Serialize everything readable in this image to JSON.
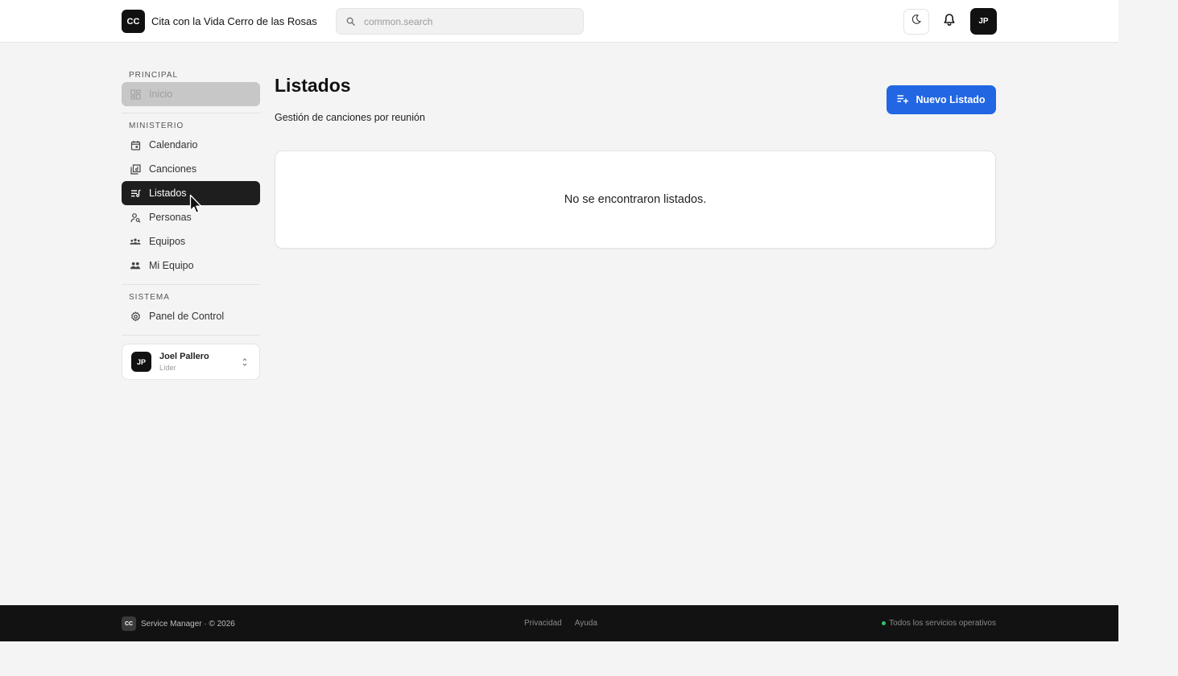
{
  "header": {
    "logo_text": "CC",
    "brand_name": "Cita con la Vida Cerro de las Rosas",
    "search_placeholder": "common.search",
    "avatar_initials": "JP",
    "icons": {
      "search": "search-icon",
      "theme": "moon-icon",
      "notifications": "bell-icon"
    }
  },
  "sidebar": {
    "sections": [
      {
        "label": "PRINCIPAL",
        "items": [
          {
            "label": "Inicio",
            "icon": "dashboard-icon",
            "state": "disabled"
          }
        ]
      },
      {
        "label": "MINISTERIO",
        "items": [
          {
            "label": "Calendario",
            "icon": "calendar-icon"
          },
          {
            "label": "Canciones",
            "icon": "music-library-icon"
          },
          {
            "label": "Listados",
            "icon": "playlist-icon",
            "state": "active"
          },
          {
            "label": "Personas",
            "icon": "person-search-icon"
          },
          {
            "label": "Equipos",
            "icon": "groups-icon"
          },
          {
            "label": "Mi Equipo",
            "icon": "team-icon"
          }
        ]
      },
      {
        "label": "SISTEMA",
        "items": [
          {
            "label": "Panel de Control",
            "icon": "settings-icon"
          }
        ]
      }
    ],
    "user": {
      "initials": "JP",
      "name": "Joel Pallero",
      "role": "Líder"
    }
  },
  "main": {
    "title": "Listados",
    "subtitle": "Gestión de canciones por reunión",
    "new_button_label": "Nuevo Listado",
    "empty_message": "No se encontraron listados."
  },
  "footer": {
    "logo_text": "CC",
    "copyright": "Service Manager · © 2026",
    "links": [
      "Privacidad",
      "Ayuda"
    ],
    "status": "Todos los servicios operativos",
    "status_color": "#2ec26a"
  },
  "colors": {
    "primary": "#2266e3",
    "active_nav": "#1e1e1e",
    "footer_bg": "#121212"
  }
}
